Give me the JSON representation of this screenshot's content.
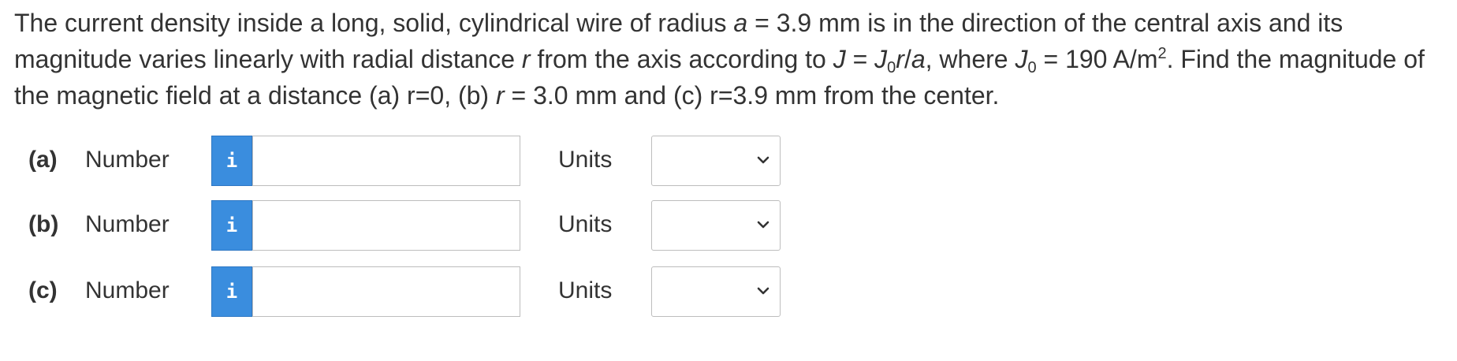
{
  "question": {
    "t1": "The current density inside a long, solid, cylindrical wire of radius ",
    "a1": "a",
    "t2": " = 3.9 mm is in the direction of the central axis and its magnitude varies linearly with radial distance ",
    "r1": "r",
    "t3": " from the axis according to ",
    "J1": "J",
    "t4": " = ",
    "J2": "J",
    "sub1": "0",
    "r2": "r",
    "t5": "/",
    "a2": "a",
    "t6": ", where ",
    "J3": "J",
    "sub2": "0",
    "t7": " = 190 A/m",
    "sup1": "2",
    "t8": ". Find the magnitude of the magnetic field at a distance (a) r=0, (b) ",
    "r3": "r",
    "t9": " = 3.0 mm and (c) r=3.9 mm from the center."
  },
  "rows": [
    {
      "part": "(a)",
      "number_label": "Number",
      "info_icon": "i",
      "number_value": "",
      "units_label": "Units",
      "units_value": ""
    },
    {
      "part": "(b)",
      "number_label": "Number",
      "info_icon": "i",
      "number_value": "",
      "units_label": "Units",
      "units_value": ""
    },
    {
      "part": "(c)",
      "number_label": "Number",
      "info_icon": "i",
      "number_value": "",
      "units_label": "Units",
      "units_value": ""
    }
  ],
  "icons": {
    "info": "info-icon",
    "chevron": "chevron-down-icon"
  },
  "colors": {
    "info_button": "#3a8dde",
    "text": "#333333",
    "border": "#bdbdbd"
  }
}
